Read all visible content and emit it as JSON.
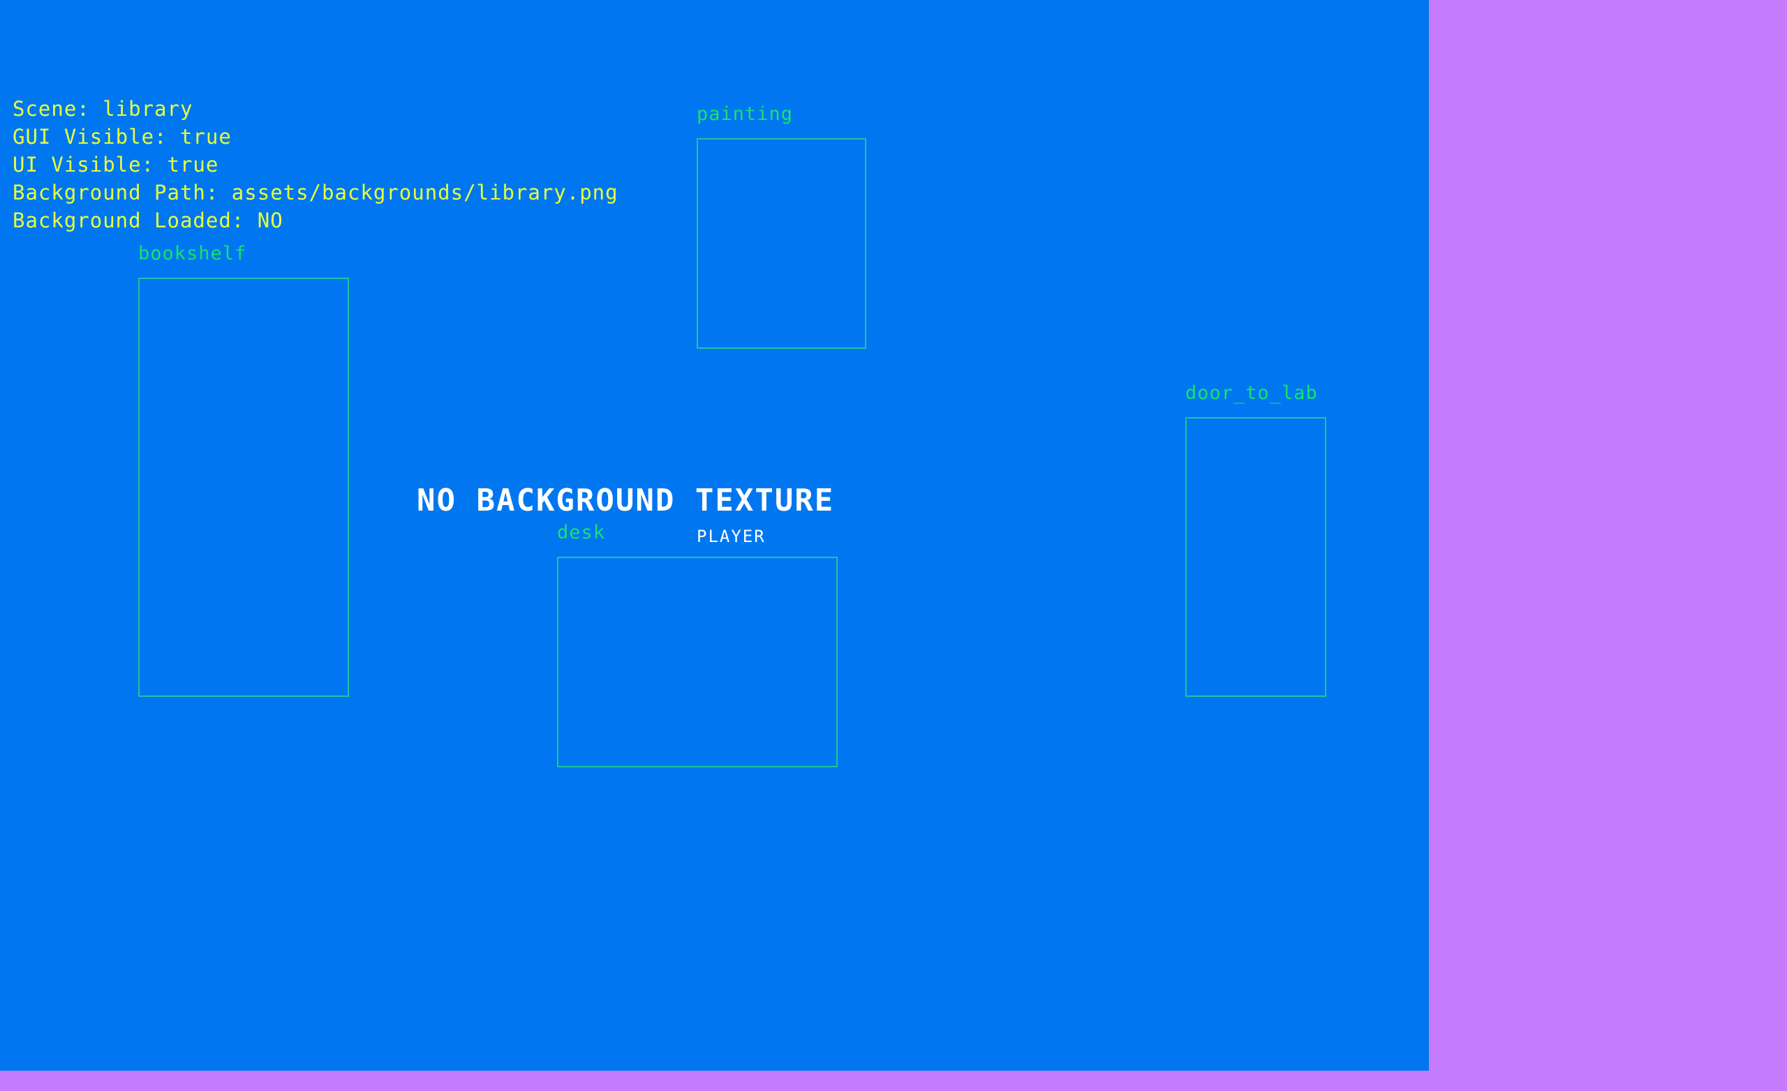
{
  "debug": {
    "scene": "Scene: library",
    "gui_visible": "GUI Visible: true",
    "ui_visible": "UI Visible: true",
    "background_path": "Background Path: assets/backgrounds/library.png",
    "background_loaded": "Background Loaded: NO"
  },
  "hotspots": {
    "painting": "painting",
    "bookshelf": "bookshelf",
    "door_to_lab": "door_to_lab",
    "desk": "desk"
  },
  "messages": {
    "no_background": "NO BACKGROUND TEXTURE",
    "player": "PLAYER"
  },
  "colors": {
    "viewport_background": "#0077f0",
    "window_background": "#c67bfc",
    "debug_text": "#e8ff3a",
    "hotspot_label": "#17e36a",
    "hotspot_border": "#1fc4a0",
    "message_text": "#ffffff"
  }
}
